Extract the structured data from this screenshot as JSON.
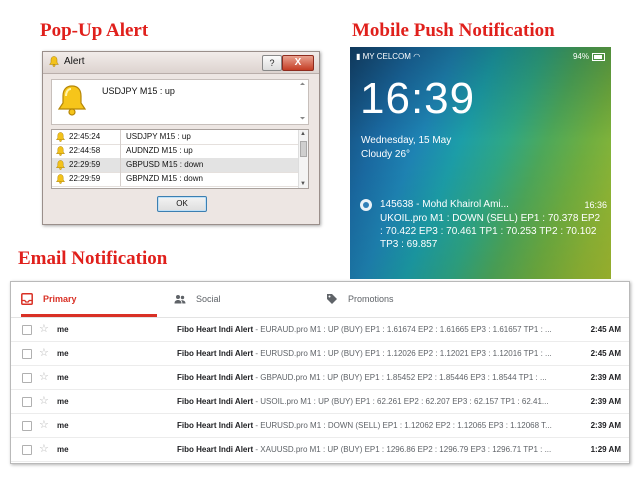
{
  "headings": {
    "popup": "Pop-Up Alert",
    "push": "Mobile Push Notification",
    "email": "Email Notification"
  },
  "alert_dialog": {
    "title": "Alert",
    "help_label": "?",
    "close_label": "X",
    "message": "USDJPY M15 : up",
    "rows": [
      {
        "time": "22:45:24",
        "text": "USDJPY M15 : up"
      },
      {
        "time": "22:44:58",
        "text": "AUDNZD M15 : up"
      },
      {
        "time": "22:29:59",
        "text": "GBPUSD M15 : down"
      },
      {
        "time": "22:29:59",
        "text": "GBPNZD M15 : down"
      }
    ],
    "ok_label": "OK",
    "icon": "bell-icon"
  },
  "phone": {
    "carrier": "MY CELCOM",
    "battery": "94%",
    "clock": "16:39",
    "date": "Wednesday, 15 May",
    "weather": "Cloudy 26°",
    "notification": {
      "title": "145638 - Mohd Khairol Ami...",
      "time": "16:36",
      "body": "UKOIL.pro M1 : DOWN (SELL) EP1 : 70.378 EP2 : 70.422 EP3 : 70.461 TP1 : 70.253 TP2 : 70.102 TP3 : 69.857"
    }
  },
  "gmail": {
    "tabs": [
      {
        "label": "Primary",
        "icon": "inbox-icon"
      },
      {
        "label": "Social",
        "icon": "people-icon"
      },
      {
        "label": "Promotions",
        "icon": "tag-icon"
      }
    ],
    "accent": "#d93025",
    "emails": [
      {
        "from": "me",
        "subject": "Fibo Heart Indi Alert",
        "snippet": " - EURAUD.pro M1 : UP (BUY) EP1 : 1.61674 EP2 : 1.61665 EP3 : 1.61657 TP1 : ...",
        "time": "2:45 AM"
      },
      {
        "from": "me",
        "subject": "Fibo Heart Indi Alert",
        "snippet": " - EURUSD.pro M1 : UP (BUY) EP1 : 1.12026 EP2 : 1.12021 EP3 : 1.12016 TP1 : ...",
        "time": "2:45 AM"
      },
      {
        "from": "me",
        "subject": "Fibo Heart Indi Alert",
        "snippet": " - GBPAUD.pro M1 : UP (BUY) EP1 : 1.85452 EP2 : 1.85446 EP3 : 1.8544 TP1 : ...",
        "time": "2:39 AM"
      },
      {
        "from": "me",
        "subject": "Fibo Heart Indi Alert",
        "snippet": " - USOIL.pro M1 : UP (BUY) EP1 : 62.261 EP2 : 62.207 EP3 : 62.157 TP1 : 62.41...",
        "time": "2:39 AM"
      },
      {
        "from": "me",
        "subject": "Fibo Heart Indi Alert",
        "snippet": " - EURUSD.pro M1 : DOWN (SELL) EP1 : 1.12062 EP2 : 1.12065 EP3 : 1.12068 T...",
        "time": "2:39 AM"
      },
      {
        "from": "me",
        "subject": "Fibo Heart Indi Alert",
        "snippet": " - XAUUSD.pro M1 : UP (BUY) EP1 : 1296.86 EP2 : 1296.79 EP3 : 1296.71 TP1 : ...",
        "time": "1:29 AM"
      }
    ]
  }
}
